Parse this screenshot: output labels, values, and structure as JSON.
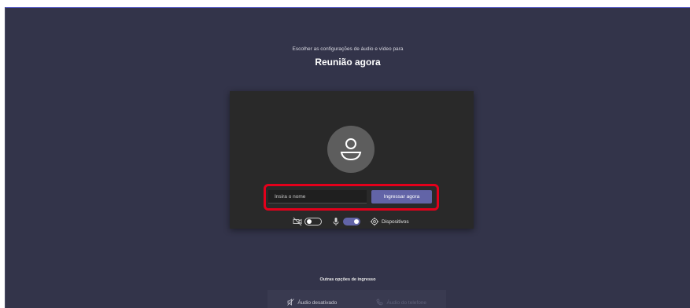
{
  "header": {
    "subtitle": "Escolher as configurações de áudio e vídeo para",
    "title": "Reunião agora"
  },
  "join": {
    "name_placeholder": "Insira o nome",
    "name_value": "",
    "join_label": "Ingressar agora"
  },
  "controls": {
    "camera_toggle": "off",
    "mic_toggle": "on",
    "devices_label": "Dispositivos"
  },
  "other_options": {
    "heading": "Outras opções de ingresso",
    "audio_off_label": "Áudio desativado",
    "phone_audio_label": "Áudio do telefone"
  },
  "colors": {
    "background": "#33344a",
    "accent": "#6264a7",
    "highlight": "#e3001b"
  },
  "icons": [
    "person-icon",
    "camera-off-icon",
    "microphone-icon",
    "gear-icon",
    "speaker-off-icon",
    "phone-icon"
  ]
}
